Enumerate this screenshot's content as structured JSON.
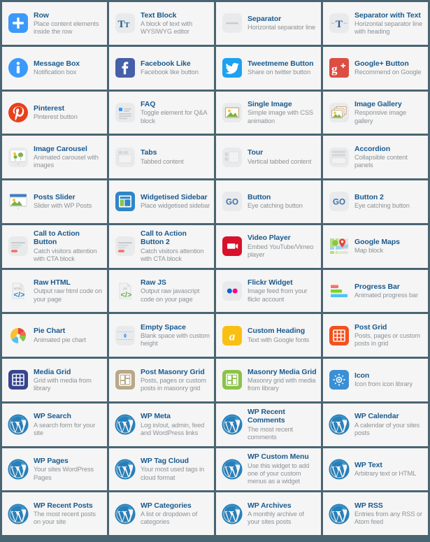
{
  "page": {
    "title": "Visual Composer Element Library",
    "background_color": "#4a6572",
    "card_background": "#f5f5f5",
    "title_color": "#1a5a8e",
    "desc_color": "#8d9296",
    "columns": 4,
    "rows": 12
  },
  "elements": [
    {
      "title": "Row",
      "desc": "Place content elements inside the row",
      "icon": "plus-square-icon",
      "icon_color": "#3b99fc"
    },
    {
      "title": "Text Block",
      "desc": "A block of text with WYSIWYG editor",
      "icon": "text-block-icon",
      "icon_color": "#2c5f8a"
    },
    {
      "title": "Separator",
      "desc": "Horizontal separator line",
      "icon": "separator-icon",
      "icon_color": "#c9ccce"
    },
    {
      "title": "Separator with Text",
      "desc": "Horizontal separator line with heading",
      "icon": "separator-with-text-icon",
      "icon_color": "#2c5f8a"
    },
    {
      "title": "Message Box",
      "desc": "Notification box",
      "icon": "info-circle-icon",
      "icon_color": "#3b99fc"
    },
    {
      "title": "Facebook Like",
      "desc": "Facebook like button",
      "icon": "facebook-icon",
      "icon_color": "#4560a8"
    },
    {
      "title": "Tweetmeme Button",
      "desc": "Share on twitter button",
      "icon": "twitter-icon",
      "icon_color": "#1da1f2"
    },
    {
      "title": "Google+ Button",
      "desc": "Recommend on Google",
      "icon": "google-plus-icon",
      "icon_color": "#dc4e41"
    },
    {
      "title": "Pinterest",
      "desc": "Pinterest button",
      "icon": "pinterest-icon",
      "icon_color": "#e8411c"
    },
    {
      "title": "FAQ",
      "desc": "Toggle element for Q&A block",
      "icon": "faq-icon",
      "icon_color": "#3b99fc"
    },
    {
      "title": "Single Image",
      "desc": "Simple image with CSS animation",
      "icon": "single-image-icon",
      "icon_color": "#7cb342"
    },
    {
      "title": "Image Gallery",
      "desc": "Responsive image gallery",
      "icon": "image-gallery-icon",
      "icon_color": "#7cb342"
    },
    {
      "title": "Image Carousel",
      "desc": "Animated carousel with images",
      "icon": "image-carousel-icon",
      "icon_color": "#7cb342"
    },
    {
      "title": "Tabs",
      "desc": "Tabbed content",
      "icon": "tabs-icon",
      "icon_color": "#d4d6d8"
    },
    {
      "title": "Tour",
      "desc": "Vertical tabbed content",
      "icon": "tour-icon",
      "icon_color": "#d4d6d8"
    },
    {
      "title": "Accordion",
      "desc": "Collapsible content panels",
      "icon": "accordion-icon",
      "icon_color": "#d4d6d8"
    },
    {
      "title": "Posts Slider",
      "desc": "Slider with WP Posts",
      "icon": "posts-slider-icon",
      "icon_color": "#3b7fc4"
    },
    {
      "title": "Widgetised Sidebar",
      "desc": "Place widgetised sidebar",
      "icon": "widgetised-sidebar-icon",
      "icon_color": "#2e86c8"
    },
    {
      "title": "Button",
      "desc": "Eye catching button",
      "icon": "go-button-icon",
      "icon_color": "#3b6fa8"
    },
    {
      "title": "Button 2",
      "desc": "Eye catching button",
      "icon": "go-button-2-icon",
      "icon_color": "#3b6fa8"
    },
    {
      "title": "Call to Action Button",
      "desc": "Catch visitors attention with CTA block",
      "icon": "cta-button-icon",
      "icon_color": "#f07167"
    },
    {
      "title": "Call to Action Button 2",
      "desc": "Catch visitors attention with CTA block",
      "icon": "cta-button-2-icon",
      "icon_color": "#f07167"
    },
    {
      "title": "Video Player",
      "desc": "Embed YouTube/Vimeo player",
      "icon": "video-player-icon",
      "icon_color": "#d8112c"
    },
    {
      "title": "Google Maps",
      "desc": "Map block",
      "icon": "google-maps-icon",
      "icon_color": "#8cc63f"
    },
    {
      "title": "Raw HTML",
      "desc": "Output raw html code on your page",
      "icon": "raw-html-icon",
      "icon_color": "#2e86c8"
    },
    {
      "title": "Raw JS",
      "desc": "Output raw javascript code on your page",
      "icon": "raw-js-icon",
      "icon_color": "#6ab04c"
    },
    {
      "title": "Flickr Widget",
      "desc": "Image feed from your flickr account",
      "icon": "flickr-icon",
      "icon_color": "#0063dc"
    },
    {
      "title": "Progress Bar",
      "desc": "Animated progress bar",
      "icon": "progress-bar-icon",
      "icon_color": "#4fc3f7"
    },
    {
      "title": "Pie Chart",
      "desc": "Animated pie chart",
      "icon": "pie-chart-icon",
      "icon_color": "#ffc107"
    },
    {
      "title": "Empty Space",
      "desc": "Blank space with custom height",
      "icon": "empty-space-icon",
      "icon_color": "#3b99fc"
    },
    {
      "title": "Custom Heading",
      "desc": "Text with Google fonts",
      "icon": "custom-heading-icon",
      "icon_color": "#f9c013"
    },
    {
      "title": "Post Grid",
      "desc": "Posts, pages or custom posts in grid",
      "icon": "post-grid-icon",
      "icon_color": "#f4511e"
    },
    {
      "title": "Media Grid",
      "desc": "Grid with media from library",
      "icon": "media-grid-icon",
      "icon_color": "#36458c"
    },
    {
      "title": "Post Masonry Grid",
      "desc": "Posts, pages or custom posts in masonry grid",
      "icon": "post-masonry-grid-icon",
      "icon_color": "#b8a888"
    },
    {
      "title": "Masonry Media Grid",
      "desc": "Masonry grid with media from library",
      "icon": "masonry-media-grid-icon",
      "icon_color": "#8bc34a"
    },
    {
      "title": "Icon",
      "desc": "Icon from icon library",
      "icon": "icon-library-icon",
      "icon_color": "#3b8fd4"
    },
    {
      "title": "WP Search",
      "desc": "A search form for your site",
      "icon": "wordpress-icon",
      "icon_color": "#2980b9"
    },
    {
      "title": "WP Meta",
      "desc": "Log in/out, admin, feed and WordPress links",
      "icon": "wordpress-icon",
      "icon_color": "#2980b9"
    },
    {
      "title": "WP Recent Comments",
      "desc": "The most recent comments",
      "icon": "wordpress-icon",
      "icon_color": "#2980b9"
    },
    {
      "title": "WP Calendar",
      "desc": "A calendar of your sites posts",
      "icon": "wordpress-icon",
      "icon_color": "#2980b9"
    },
    {
      "title": "WP Pages",
      "desc": "Your sites WordPress Pages",
      "icon": "wordpress-icon",
      "icon_color": "#2980b9"
    },
    {
      "title": "WP Tag Cloud",
      "desc": "Your most used tags in cloud format",
      "icon": "wordpress-icon",
      "icon_color": "#2980b9"
    },
    {
      "title": "WP Custom Menu",
      "desc": "Use this widget to add one of your custom menus as a widget",
      "icon": "wordpress-icon",
      "icon_color": "#2980b9"
    },
    {
      "title": "WP Text",
      "desc": "Arbitrary text or HTML",
      "icon": "wordpress-icon",
      "icon_color": "#2980b9"
    },
    {
      "title": "WP Recent Posts",
      "desc": "The most recent posts on your site",
      "icon": "wordpress-icon",
      "icon_color": "#2980b9"
    },
    {
      "title": "WP Categories",
      "desc": "A list or dropdown of categories",
      "icon": "wordpress-icon",
      "icon_color": "#2980b9"
    },
    {
      "title": "WP Archives",
      "desc": "A monthly archive of your sites posts",
      "icon": "wordpress-icon",
      "icon_color": "#2980b9"
    },
    {
      "title": "WP RSS",
      "desc": "Entries from any RSS or Atom feed",
      "icon": "wordpress-icon",
      "icon_color": "#2980b9"
    }
  ]
}
